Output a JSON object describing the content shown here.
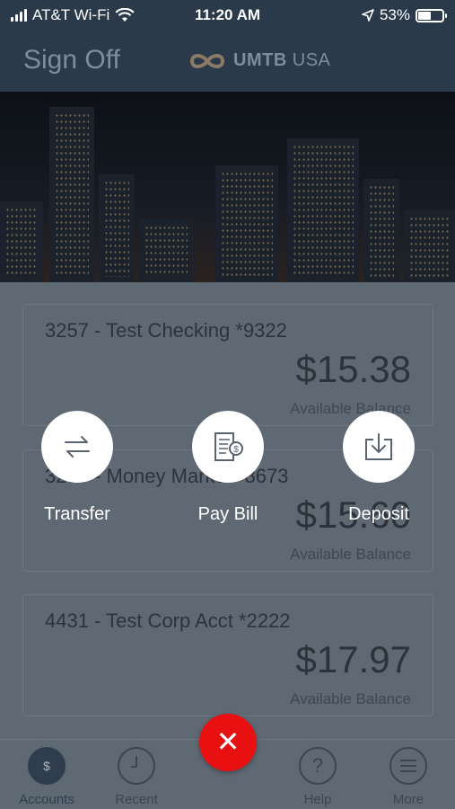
{
  "status_bar": {
    "carrier": "AT&T Wi-Fi",
    "time": "11:20 AM",
    "battery": "53%",
    "battery_level": 0.53
  },
  "header": {
    "sign_off": "Sign Off",
    "logo_brand": "UMTB",
    "logo_suffix": "USA"
  },
  "accounts": [
    {
      "name": "3257 - Test Checking *9322",
      "amount": "$15.38",
      "balance_label": "Available Balance"
    },
    {
      "name": "3257 - Money Market *8673",
      "amount": "$15.60",
      "balance_label": "Available Balance"
    },
    {
      "name": "4431 - Test Corp Acct *2222",
      "amount": "$17.97",
      "balance_label": "Available Balance"
    }
  ],
  "quick_actions": [
    {
      "label": "Transfer",
      "icon": "transfer-arrows-icon"
    },
    {
      "label": "Pay Bill",
      "icon": "bill-icon"
    },
    {
      "label": "Deposit",
      "icon": "download-tray-icon"
    }
  ],
  "tabbar": {
    "accounts": "Accounts",
    "recent": "Recent",
    "help": "Help",
    "more": "More",
    "close_symbol": "✕"
  },
  "colors": {
    "close_button": "#e81010",
    "overlay": "#5f6974"
  }
}
